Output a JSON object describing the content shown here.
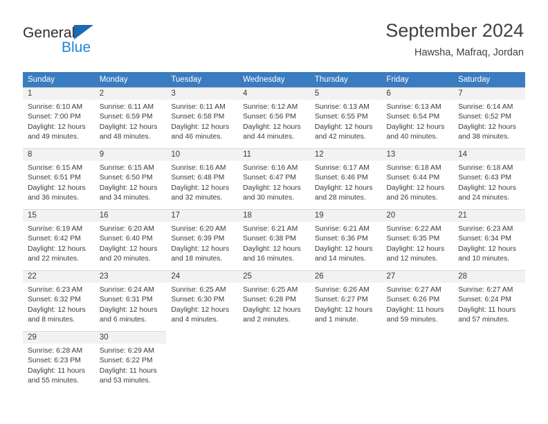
{
  "brand": {
    "line1": "General",
    "line2": "Blue",
    "triangle_color": "#1a6bb5",
    "blue_color": "#1d85d6"
  },
  "header": {
    "title": "September 2024",
    "subtitle": "Hawsha, Mafraq, Jordan"
  },
  "theme": {
    "header_row_bg": "#3a7cc0",
    "daynum_band_bg": "#f2f2f2",
    "text_color": "#3a3a3a"
  },
  "weekdays": [
    "Sunday",
    "Monday",
    "Tuesday",
    "Wednesday",
    "Thursday",
    "Friday",
    "Saturday"
  ],
  "weeks": [
    [
      {
        "day": "1",
        "sunrise": "Sunrise: 6:10 AM",
        "sunset": "Sunset: 7:00 PM",
        "daylight1": "Daylight: 12 hours",
        "daylight2": "and 49 minutes."
      },
      {
        "day": "2",
        "sunrise": "Sunrise: 6:11 AM",
        "sunset": "Sunset: 6:59 PM",
        "daylight1": "Daylight: 12 hours",
        "daylight2": "and 48 minutes."
      },
      {
        "day": "3",
        "sunrise": "Sunrise: 6:11 AM",
        "sunset": "Sunset: 6:58 PM",
        "daylight1": "Daylight: 12 hours",
        "daylight2": "and 46 minutes."
      },
      {
        "day": "4",
        "sunrise": "Sunrise: 6:12 AM",
        "sunset": "Sunset: 6:56 PM",
        "daylight1": "Daylight: 12 hours",
        "daylight2": "and 44 minutes."
      },
      {
        "day": "5",
        "sunrise": "Sunrise: 6:13 AM",
        "sunset": "Sunset: 6:55 PM",
        "daylight1": "Daylight: 12 hours",
        "daylight2": "and 42 minutes."
      },
      {
        "day": "6",
        "sunrise": "Sunrise: 6:13 AM",
        "sunset": "Sunset: 6:54 PM",
        "daylight1": "Daylight: 12 hours",
        "daylight2": "and 40 minutes."
      },
      {
        "day": "7",
        "sunrise": "Sunrise: 6:14 AM",
        "sunset": "Sunset: 6:52 PM",
        "daylight1": "Daylight: 12 hours",
        "daylight2": "and 38 minutes."
      }
    ],
    [
      {
        "day": "8",
        "sunrise": "Sunrise: 6:15 AM",
        "sunset": "Sunset: 6:51 PM",
        "daylight1": "Daylight: 12 hours",
        "daylight2": "and 36 minutes."
      },
      {
        "day": "9",
        "sunrise": "Sunrise: 6:15 AM",
        "sunset": "Sunset: 6:50 PM",
        "daylight1": "Daylight: 12 hours",
        "daylight2": "and 34 minutes."
      },
      {
        "day": "10",
        "sunrise": "Sunrise: 6:16 AM",
        "sunset": "Sunset: 6:48 PM",
        "daylight1": "Daylight: 12 hours",
        "daylight2": "and 32 minutes."
      },
      {
        "day": "11",
        "sunrise": "Sunrise: 6:16 AM",
        "sunset": "Sunset: 6:47 PM",
        "daylight1": "Daylight: 12 hours",
        "daylight2": "and 30 minutes."
      },
      {
        "day": "12",
        "sunrise": "Sunrise: 6:17 AM",
        "sunset": "Sunset: 6:46 PM",
        "daylight1": "Daylight: 12 hours",
        "daylight2": "and 28 minutes."
      },
      {
        "day": "13",
        "sunrise": "Sunrise: 6:18 AM",
        "sunset": "Sunset: 6:44 PM",
        "daylight1": "Daylight: 12 hours",
        "daylight2": "and 26 minutes."
      },
      {
        "day": "14",
        "sunrise": "Sunrise: 6:18 AM",
        "sunset": "Sunset: 6:43 PM",
        "daylight1": "Daylight: 12 hours",
        "daylight2": "and 24 minutes."
      }
    ],
    [
      {
        "day": "15",
        "sunrise": "Sunrise: 6:19 AM",
        "sunset": "Sunset: 6:42 PM",
        "daylight1": "Daylight: 12 hours",
        "daylight2": "and 22 minutes."
      },
      {
        "day": "16",
        "sunrise": "Sunrise: 6:20 AM",
        "sunset": "Sunset: 6:40 PM",
        "daylight1": "Daylight: 12 hours",
        "daylight2": "and 20 minutes."
      },
      {
        "day": "17",
        "sunrise": "Sunrise: 6:20 AM",
        "sunset": "Sunset: 6:39 PM",
        "daylight1": "Daylight: 12 hours",
        "daylight2": "and 18 minutes."
      },
      {
        "day": "18",
        "sunrise": "Sunrise: 6:21 AM",
        "sunset": "Sunset: 6:38 PM",
        "daylight1": "Daylight: 12 hours",
        "daylight2": "and 16 minutes."
      },
      {
        "day": "19",
        "sunrise": "Sunrise: 6:21 AM",
        "sunset": "Sunset: 6:36 PM",
        "daylight1": "Daylight: 12 hours",
        "daylight2": "and 14 minutes."
      },
      {
        "day": "20",
        "sunrise": "Sunrise: 6:22 AM",
        "sunset": "Sunset: 6:35 PM",
        "daylight1": "Daylight: 12 hours",
        "daylight2": "and 12 minutes."
      },
      {
        "day": "21",
        "sunrise": "Sunrise: 6:23 AM",
        "sunset": "Sunset: 6:34 PM",
        "daylight1": "Daylight: 12 hours",
        "daylight2": "and 10 minutes."
      }
    ],
    [
      {
        "day": "22",
        "sunrise": "Sunrise: 6:23 AM",
        "sunset": "Sunset: 6:32 PM",
        "daylight1": "Daylight: 12 hours",
        "daylight2": "and 8 minutes."
      },
      {
        "day": "23",
        "sunrise": "Sunrise: 6:24 AM",
        "sunset": "Sunset: 6:31 PM",
        "daylight1": "Daylight: 12 hours",
        "daylight2": "and 6 minutes."
      },
      {
        "day": "24",
        "sunrise": "Sunrise: 6:25 AM",
        "sunset": "Sunset: 6:30 PM",
        "daylight1": "Daylight: 12 hours",
        "daylight2": "and 4 minutes."
      },
      {
        "day": "25",
        "sunrise": "Sunrise: 6:25 AM",
        "sunset": "Sunset: 6:28 PM",
        "daylight1": "Daylight: 12 hours",
        "daylight2": "and 2 minutes."
      },
      {
        "day": "26",
        "sunrise": "Sunrise: 6:26 AM",
        "sunset": "Sunset: 6:27 PM",
        "daylight1": "Daylight: 12 hours",
        "daylight2": "and 1 minute."
      },
      {
        "day": "27",
        "sunrise": "Sunrise: 6:27 AM",
        "sunset": "Sunset: 6:26 PM",
        "daylight1": "Daylight: 11 hours",
        "daylight2": "and 59 minutes."
      },
      {
        "day": "28",
        "sunrise": "Sunrise: 6:27 AM",
        "sunset": "Sunset: 6:24 PM",
        "daylight1": "Daylight: 11 hours",
        "daylight2": "and 57 minutes."
      }
    ],
    [
      {
        "day": "29",
        "sunrise": "Sunrise: 6:28 AM",
        "sunset": "Sunset: 6:23 PM",
        "daylight1": "Daylight: 11 hours",
        "daylight2": "and 55 minutes."
      },
      {
        "day": "30",
        "sunrise": "Sunrise: 6:29 AM",
        "sunset": "Sunset: 6:22 PM",
        "daylight1": "Daylight: 11 hours",
        "daylight2": "and 53 minutes."
      },
      null,
      null,
      null,
      null,
      null
    ]
  ]
}
